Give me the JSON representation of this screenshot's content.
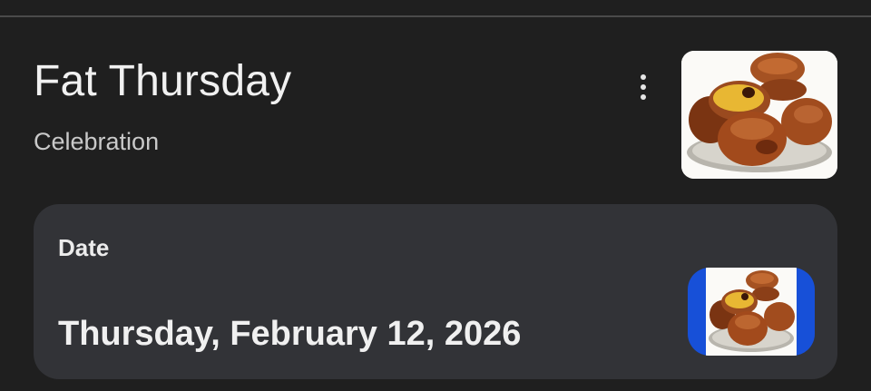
{
  "header": {
    "title": "Fat Thursday",
    "subtitle": "Celebration",
    "menu_icon": "more-vert-icon",
    "image": "paczki-donuts-photo"
  },
  "date_card": {
    "label": "Date",
    "value": "Thursday, February 12, 2026",
    "thumbnail": "paczki-donuts-thumbnail"
  },
  "colors": {
    "background": "#1f1f1f",
    "card": "#323337",
    "thumbnail_border": "#1750d8",
    "title_text": "#f1f1f1",
    "subtitle_text": "#c9c9c9"
  }
}
